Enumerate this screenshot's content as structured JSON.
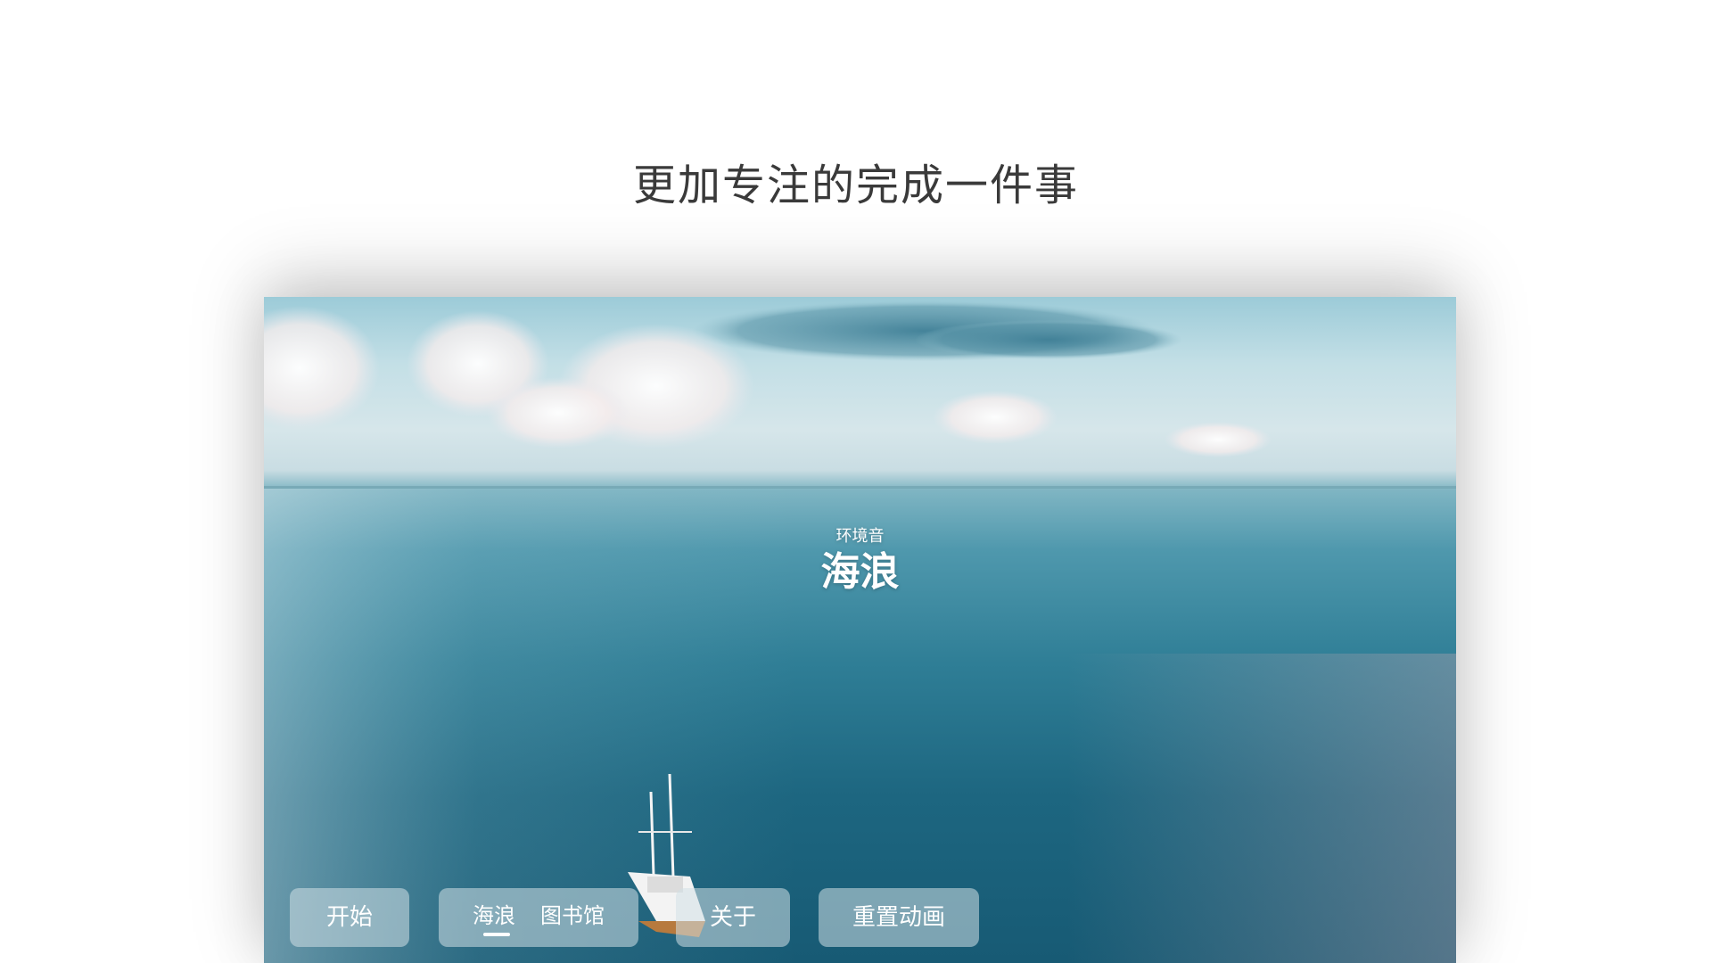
{
  "headline": "更加专注的完成一件事",
  "scene": {
    "caption_sub": "环境音",
    "caption_main": "海浪"
  },
  "controls": {
    "start_label": "开始",
    "sound_tab_label": "海浪",
    "library_tab_label": "图书馆",
    "about_label": "关于",
    "reset_label": "重置动画"
  },
  "colors": {
    "sky_top": "#9ccbd8",
    "sea_deep": "#175a74",
    "button_bg": "rgba(210,224,230,0.55)"
  }
}
